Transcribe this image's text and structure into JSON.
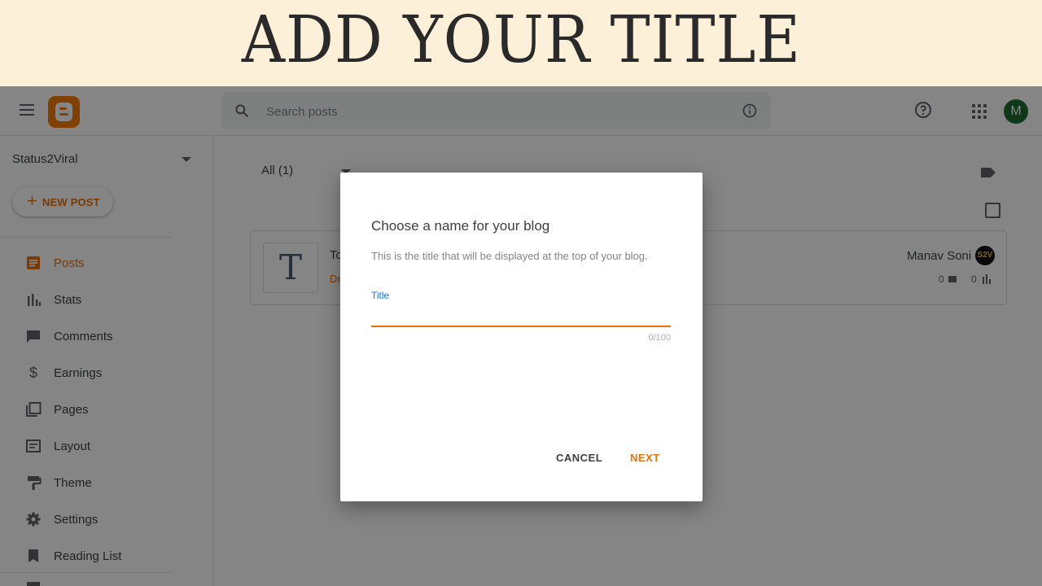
{
  "banner": {
    "title": "ADD YOUR TITLE"
  },
  "topbar": {
    "search_placeholder": "Search posts",
    "avatar_initial": "M",
    "accent_color": "#f57d00"
  },
  "sidebar": {
    "blog_name": "Status2Viral",
    "new_post_label": "NEW POST",
    "items": [
      {
        "label": "Posts",
        "icon": "posts-icon",
        "active": true
      },
      {
        "label": "Stats",
        "icon": "stats-icon",
        "active": false
      },
      {
        "label": "Comments",
        "icon": "comments-icon",
        "active": false
      },
      {
        "label": "Earnings",
        "icon": "dollar-icon",
        "active": false
      },
      {
        "label": "Pages",
        "icon": "pages-icon",
        "active": false
      },
      {
        "label": "Layout",
        "icon": "layout-icon",
        "active": false
      },
      {
        "label": "Theme",
        "icon": "paint-roller-icon",
        "active": false
      },
      {
        "label": "Settings",
        "icon": "gear-icon",
        "active": false
      },
      {
        "label": "Reading List",
        "icon": "bookmark-icon",
        "active": false
      }
    ]
  },
  "main": {
    "filter_label": "All (1)",
    "post": {
      "thumb_letter": "T",
      "title_fragment": "To",
      "status_fragment": "Dr",
      "author": "Manav Soni",
      "author_badge": "S2V",
      "comments": "0",
      "views": "0"
    }
  },
  "dialog": {
    "title": "Choose a name for your blog",
    "subtitle": "This is the title that will be displayed at the top of your blog.",
    "field_label": "Title",
    "field_value": "",
    "counter": "0/100",
    "cancel_label": "CANCEL",
    "next_label": "NEXT"
  }
}
